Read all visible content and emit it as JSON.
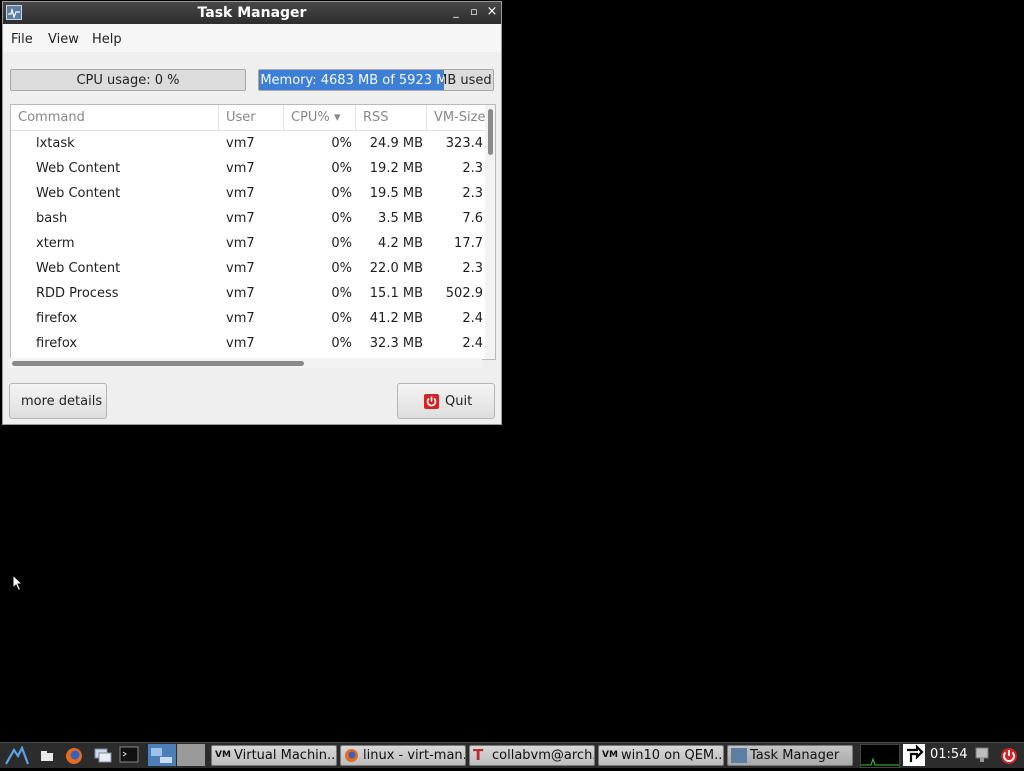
{
  "window": {
    "title": "Task Manager",
    "controls": [
      "_",
      "▫",
      "×"
    ]
  },
  "menu": [
    "File",
    "View",
    "Help"
  ],
  "cpu": {
    "label": "CPU usage: 0 %",
    "fraction": 0.0
  },
  "memory": {
    "label": "Memory: 4683 MB of 5923 MB used",
    "fraction": 0.79
  },
  "table": {
    "columns": [
      "Command",
      "User",
      "CPU%",
      "RSS",
      "VM-Size"
    ],
    "sort_indicator": "▾",
    "rows": [
      [
        "lxtask",
        "vm7",
        "0%",
        "24.9 MB",
        "323.4"
      ],
      [
        "Web Content",
        "vm7",
        "0%",
        "19.2 MB",
        "2.3"
      ],
      [
        "Web Content",
        "vm7",
        "0%",
        "19.5 MB",
        "2.3"
      ],
      [
        "bash",
        "vm7",
        "0%",
        "3.5 MB",
        "7.6"
      ],
      [
        "xterm",
        "vm7",
        "0%",
        "4.2 MB",
        "17.7"
      ],
      [
        "Web Content",
        "vm7",
        "0%",
        "22.0 MB",
        "2.3"
      ],
      [
        "RDD Process",
        "vm7",
        "0%",
        "15.1 MB",
        "502.9"
      ],
      [
        "firefox",
        "vm7",
        "0%",
        "41.2 MB",
        "2.4"
      ],
      [
        "firefox",
        "vm7",
        "0%",
        "32.3 MB",
        "2.4"
      ]
    ]
  },
  "buttons": {
    "details": "more details",
    "quit": "Quit"
  },
  "taskbar": {
    "tasks": [
      "Virtual Machin...",
      "linux - virt-man...",
      "collabvm@arch...",
      "win10 on QEM...",
      "Task Manager"
    ],
    "clock": "01:54"
  },
  "colors": {
    "accent": "#3d7fd6",
    "quit_icon": "#d0262a"
  }
}
